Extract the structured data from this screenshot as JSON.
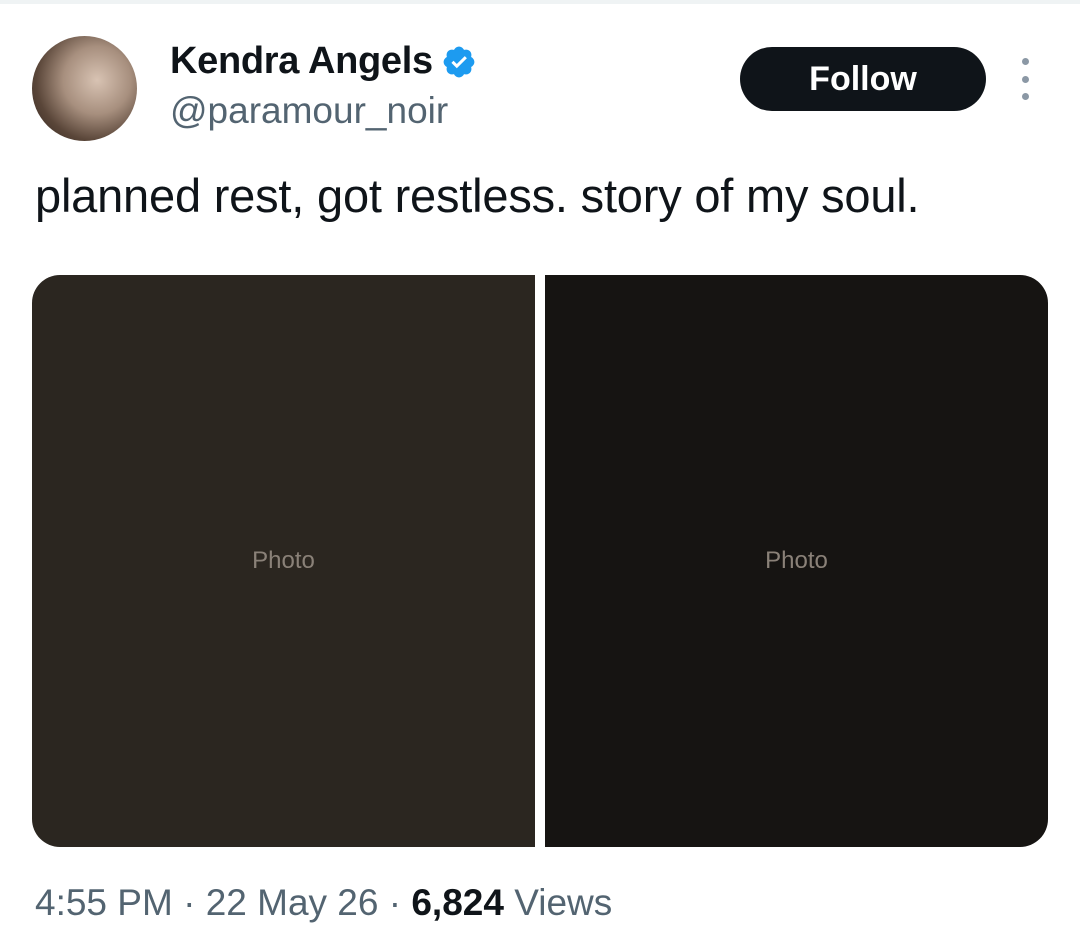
{
  "author": {
    "name": "Kendra Angels",
    "handle": "@paramour_noir",
    "verified": true,
    "verified_color": "#1d9bf0"
  },
  "actions": {
    "follow_label": "Follow",
    "more_icon": "more-vertical-icon"
  },
  "tweet": {
    "text": "planned rest, got restless. story of my soul."
  },
  "media": {
    "count": 2,
    "placeholder_label": "Photo"
  },
  "meta": {
    "time": "4:55 PM",
    "sep1": " · ",
    "date": "22 May 26",
    "sep2": " · ",
    "views_count": "6,824",
    "views_label": " Views"
  },
  "colors": {
    "text": "#0f1419",
    "secondary": "#536471",
    "button_bg": "#0f1419"
  }
}
